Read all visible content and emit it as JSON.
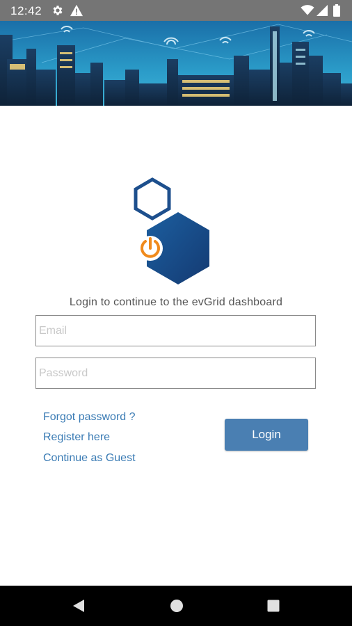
{
  "status_bar": {
    "time": "12:42",
    "icons": [
      "gear-icon",
      "alert-icon",
      "wifi-icon",
      "signal-icon",
      "battery-icon"
    ]
  },
  "login": {
    "subtitle": "Login to continue to the evGrid dashboard",
    "email_placeholder": "Email",
    "password_placeholder": "Password",
    "forgot_label": "Forgot password ?",
    "register_label": "Register here",
    "guest_label": "Continue as Guest",
    "login_button": "Login"
  },
  "colors": {
    "accent": "#4a7fb2",
    "link": "#3a7bb4",
    "logo_blue": "#1e4f8a",
    "logo_orange": "#f08a1c"
  },
  "nav_bar": {
    "icons": [
      "back-icon",
      "home-icon",
      "recent-apps-icon"
    ]
  }
}
